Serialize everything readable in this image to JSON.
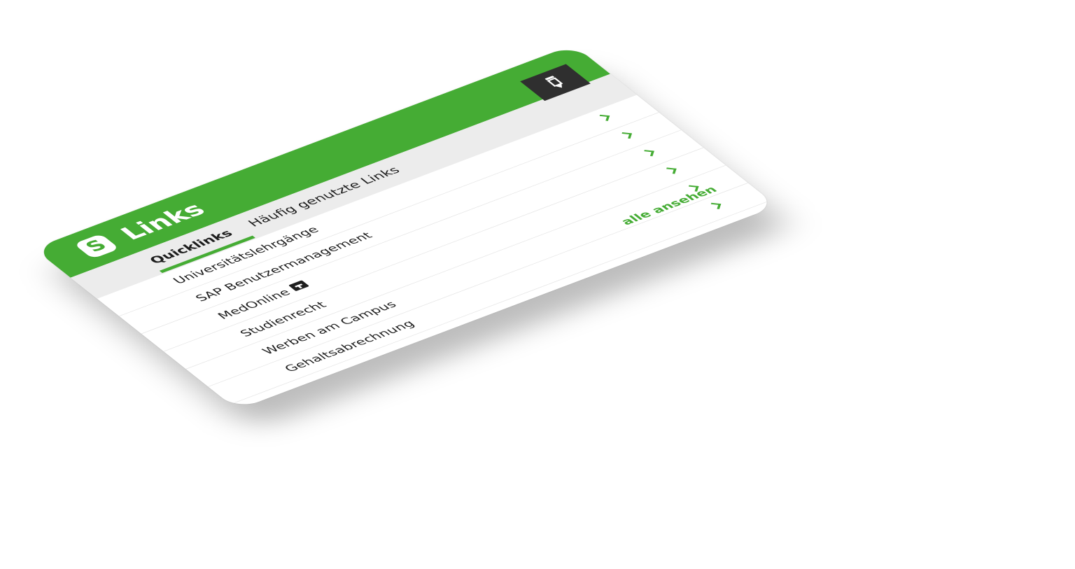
{
  "widget": {
    "title": "Links",
    "logo_glyph": "S",
    "accent_color": "#45ac34",
    "edit_icon": "pencil-icon"
  },
  "tabs": [
    {
      "label": "Quicklinks",
      "active": true
    },
    {
      "label": "Häufig genutzte Links",
      "active": false
    }
  ],
  "links": [
    {
      "label": "Universitätslehrgänge"
    },
    {
      "label": "SAP Benutzermanagement"
    },
    {
      "label": "MedOnline",
      "badge_icon": "t-badge-icon"
    },
    {
      "label": "Studienrecht"
    },
    {
      "label": "Werben am Campus"
    },
    {
      "label": "Gehaltsabrechnung"
    }
  ],
  "footer": {
    "see_all_label": "alle ansehen"
  }
}
